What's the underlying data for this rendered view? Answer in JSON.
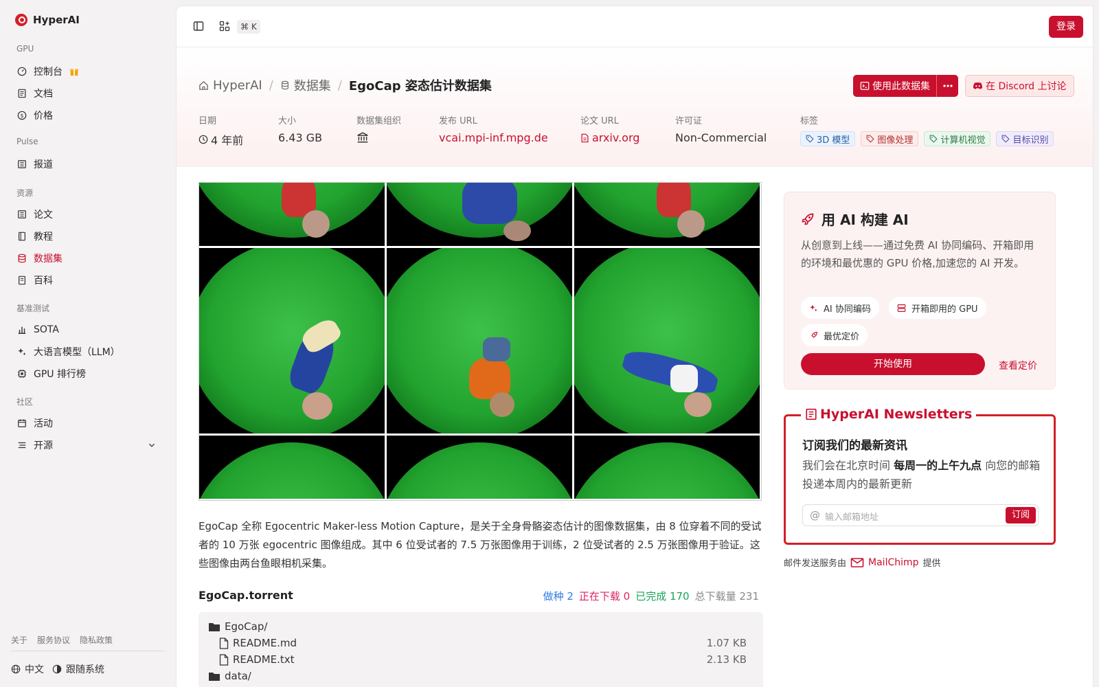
{
  "brand": {
    "name": "HyperAI"
  },
  "sidebar": {
    "sections": {
      "gpu": "GPU",
      "pulse": "Pulse",
      "resources": "资源",
      "benchmark": "基准测试",
      "community": "社区"
    },
    "items": {
      "console": "控制台",
      "docs": "文档",
      "pricing": "价格",
      "news": "报道",
      "papers": "论文",
      "tutorials": "教程",
      "datasets": "数据集",
      "wiki": "百科",
      "sota": "SOTA",
      "llm": "大语言模型（LLM）",
      "gpu_rank": "GPU 排行榜",
      "events": "活动",
      "opensource": "开源"
    },
    "footer": {
      "about": "关于",
      "terms": "服务协议",
      "privacy": "隐私政策",
      "lang": "中文",
      "theme": "跟随系统"
    }
  },
  "topbar": {
    "shortcut": "⌘ K",
    "login": "登录"
  },
  "breadcrumb": {
    "home": "HyperAI",
    "datasets": "数据集",
    "current": "EgoCap 姿态估计数据集"
  },
  "actions": {
    "use_dataset": "使用此数据集",
    "discord": "在 Discord 上讨论"
  },
  "meta": {
    "date_label": "日期",
    "date_value": "4 年前",
    "size_label": "大小",
    "size_value": "6.43 GB",
    "org_label": "数据集组织",
    "url_label": "发布 URL",
    "url_value": "vcai.mpi-inf.mpg.de",
    "paper_label": "论文 URL",
    "paper_value": "arxiv.org",
    "license_label": "许可证",
    "license_value": "Non-Commercial",
    "tags_label": "标签",
    "tags": [
      "3D 模型",
      "图像处理",
      "计算机视觉",
      "目标识别"
    ]
  },
  "description": "EgoCap 全称 Egocentric Maker-less Motion Capture，是关于全身骨骼姿态估计的图像数据集，由 8 位穿着不同的受试者的 10 万张 egocentric 图像组成。其中 6 位受试者的 7.5 万张图像用于训练，2 位受试者的 2.5 万张图像用于验证。这些图像由两台鱼眼相机采集。",
  "torrent": {
    "name": "EgoCap.torrent",
    "seeding": "做种 2",
    "downloading": "正在下载 0",
    "completed": "已完成 170",
    "total": "总下载量 231",
    "files": [
      {
        "name": "EgoCap/",
        "size": ""
      },
      {
        "name": "README.md",
        "size": "1.07 KB"
      },
      {
        "name": "README.txt",
        "size": "2.13 KB"
      },
      {
        "name": "data/",
        "size": ""
      }
    ]
  },
  "promo": {
    "title": "用 AI 构建 AI",
    "desc": "从创意到上线——通过免费 AI 协同编码、开箱即用的环境和最优惠的 GPU 价格,加速您的 AI 开发。",
    "chips": [
      "AI 协同编码",
      "开箱即用的 GPU",
      "最优定价"
    ],
    "start": "开始使用",
    "pricing": "查看定价"
  },
  "newsletter": {
    "title": "HyperAI Newsletters",
    "heading": "订阅我们的最新资讯",
    "p_pre": "我们会在北京时间 ",
    "p_bold": "每周一的上午九点",
    "p_post": " 向您的邮箱投递本周内的最新更新",
    "placeholder": "输入邮箱地址",
    "subscribe": "订阅"
  },
  "mail_provider": {
    "pre": "邮件发送服务由",
    "name": "MailChimp",
    "post": "提供"
  },
  "colors": {
    "accent": "#c8102e",
    "seed": "#2f7de1",
    "downloading": "#e0245e",
    "completed": "#1aa35a"
  }
}
